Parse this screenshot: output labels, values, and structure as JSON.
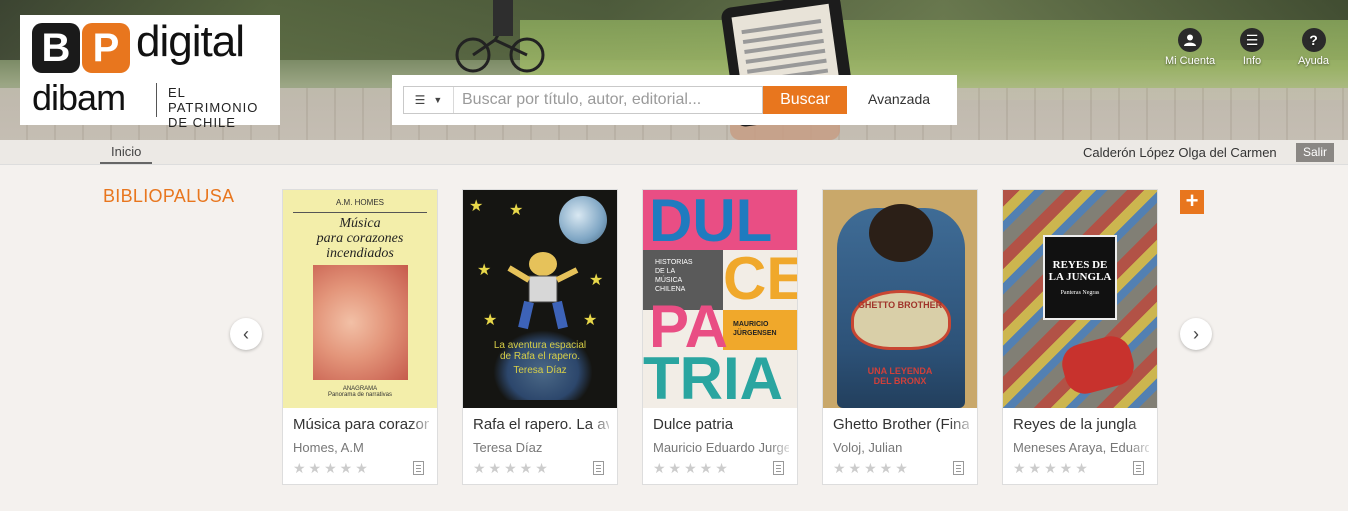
{
  "header": {
    "logo": {
      "b": "B",
      "p": "P",
      "digital": "digital",
      "dibam": "dibam",
      "tagline_1": "EL PATRIMONIO",
      "tagline_2": "DE CHILE"
    },
    "search": {
      "placeholder": "Buscar por título, autor, editorial...",
      "button": "Buscar",
      "advanced": "Avanzada",
      "type_icon": "list-icon"
    },
    "nav": [
      {
        "label": "Mi Cuenta",
        "icon": "user-icon"
      },
      {
        "label": "Info",
        "icon": "menu-icon"
      },
      {
        "label": "Ayuda",
        "icon": "help-icon"
      }
    ]
  },
  "subbar": {
    "breadcrumb": "Inicio",
    "user": "Calderón López Olga del Carmen",
    "logout": "Salir"
  },
  "shelf": {
    "title": "BIBLIOPALUSA",
    "more": "+",
    "prev_icon": "chevron-left-icon",
    "next_icon": "chevron-right-icon",
    "books": [
      {
        "title": "Música para corazones incendiados",
        "author": "Homes, A.M",
        "rating": 0,
        "max_rating": 5
      },
      {
        "title": "Rafa el rapero. La aventura espacial de Rafa el rapero",
        "author": "Teresa Díaz",
        "rating": 0,
        "max_rating": 5
      },
      {
        "title": "Dulce patria",
        "author": "Mauricio Eduardo Jurgensen",
        "rating": 0,
        "max_rating": 5
      },
      {
        "title": "Ghetto Brother (Final)",
        "author": "Voloj, Julian",
        "rating": 0,
        "max_rating": 5
      },
      {
        "title": "Reyes de la jungla",
        "author": "Meneses Araya, Eduardo",
        "rating": 0,
        "max_rating": 5
      }
    ],
    "covers": {
      "b1": {
        "author": "A.M. HOMES",
        "title_1": "Música",
        "title_2": "para corazones",
        "title_3": "incendiados",
        "publisher": "ANAGRAMA",
        "series": "Panorama de narrativas"
      },
      "b2": {
        "line_1": "La aventura espacial",
        "line_2": "de Rafa el rapero.",
        "author": "Teresa Díaz"
      },
      "b3": {
        "l1": "DUL",
        "l2": "CE",
        "l3": "PA",
        "l4": "TRIA",
        "subtitle_1": "HISTORIAS",
        "subtitle_2": "DE LA",
        "subtitle_3": "MÚSICA",
        "subtitle_4": "CHILENA",
        "author_1": "MAURICIO",
        "author_2": "JÜRGENSEN"
      },
      "b4": {
        "badge": "GHETTO BROTHER",
        "caption_1": "UNA LEYENDA",
        "caption_2": "DEL BRONX"
      },
      "b5": {
        "title_1": "REYES DE",
        "title_2": "LA JUNGLA",
        "subtitle": "Panteras Negras"
      }
    }
  },
  "colors": {
    "accent": "#e8761e",
    "logo_dark": "#1a1a1a"
  }
}
